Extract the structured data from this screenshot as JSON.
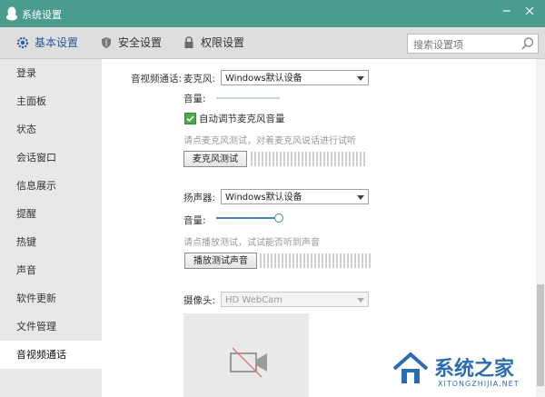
{
  "window": {
    "title": "系统设置"
  },
  "tabs": [
    {
      "label": "基本设置",
      "active": true
    },
    {
      "label": "安全设置",
      "active": false
    },
    {
      "label": "权限设置",
      "active": false
    }
  ],
  "search": {
    "placeholder": "搜索设置项"
  },
  "sidebar": {
    "items": [
      {
        "label": "登录"
      },
      {
        "label": "主面板"
      },
      {
        "label": "状态"
      },
      {
        "label": "会话窗口"
      },
      {
        "label": "信息展示"
      },
      {
        "label": "提醒"
      },
      {
        "label": "热键"
      },
      {
        "label": "声音"
      },
      {
        "label": "软件更新"
      },
      {
        "label": "文件管理"
      },
      {
        "label": "音视频通话"
      }
    ],
    "active_index": 10
  },
  "av": {
    "section_label": "音视频通话:",
    "mic": {
      "label": "麦克风:",
      "device": "Windows默认设备",
      "volume_label": "音量:",
      "volume_level": 0,
      "auto_adjust_label": "自动调节麦克风音量",
      "auto_adjust_checked": true,
      "hint": "请点麦克风测试，对着麦克风说话进行试听",
      "test_button": "麦克风测试"
    },
    "speaker": {
      "label": "扬声器:",
      "device": "Windows默认设备",
      "volume_label": "音量:",
      "volume_level": 1.0,
      "hint": "请点播放测试，试试能否听到声音",
      "test_button": "播放测试声音"
    },
    "camera": {
      "label": "摄像头:",
      "device": "HD WebCam"
    }
  },
  "watermark": {
    "text": "系统之家",
    "url": "XITONGZHIJIA.NET"
  },
  "colors": {
    "titlebar": "#4a9c8f",
    "accent": "#2a5a9c",
    "checkbox": "#4caa4c",
    "slider": "#4a7fc1"
  }
}
